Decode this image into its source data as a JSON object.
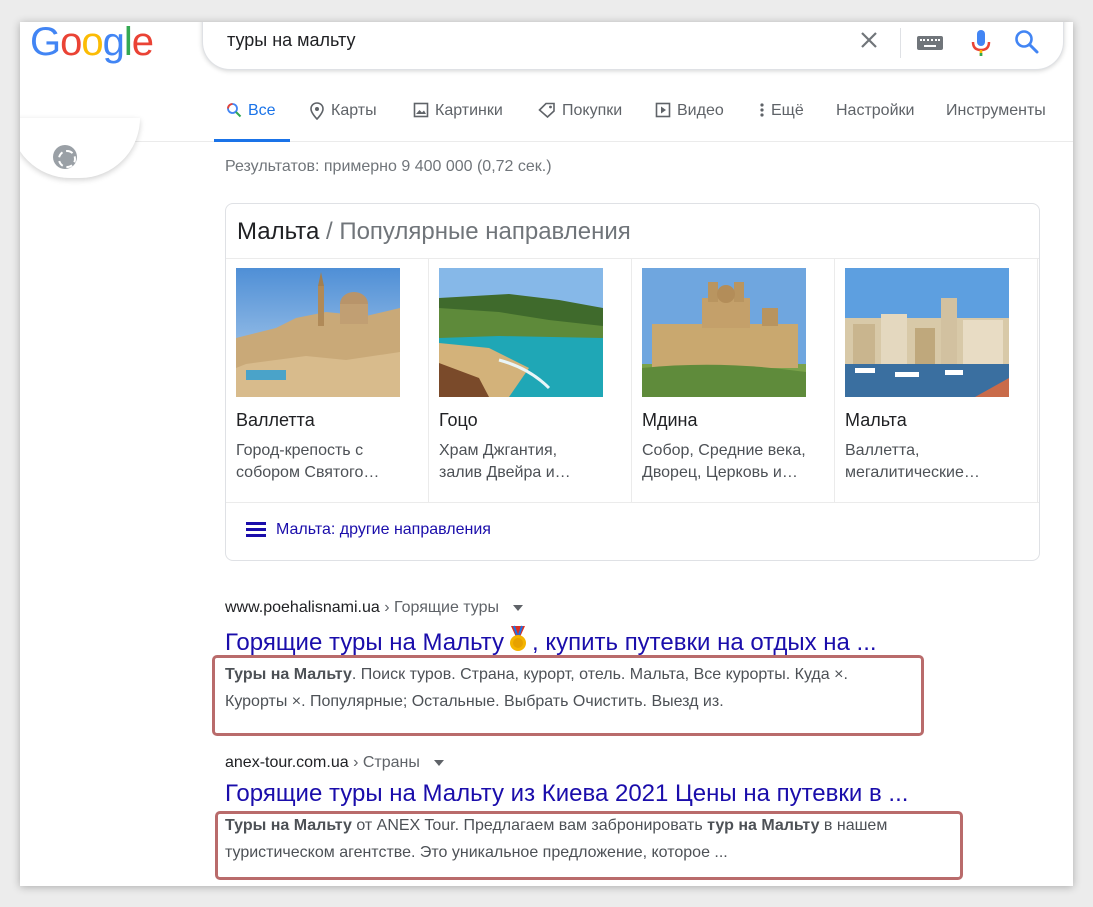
{
  "search": {
    "query": "туры на мальту"
  },
  "logo": [
    "G",
    "o",
    "o",
    "g",
    "l",
    "e"
  ],
  "tabs": [
    {
      "label": "Все",
      "icon": "search-icon"
    },
    {
      "label": "Карты",
      "icon": "map-pin-icon"
    },
    {
      "label": "Картинки",
      "icon": "image-icon"
    },
    {
      "label": "Покупки",
      "icon": "tag-icon"
    },
    {
      "label": "Видео",
      "icon": "play-icon"
    },
    {
      "label": "Ещё",
      "icon": "more-vert-icon"
    },
    {
      "label": "Настройки",
      "icon": ""
    },
    {
      "label": "Инструменты",
      "icon": ""
    }
  ],
  "stats": "Результатов: примерно 9 400 000 (0,72 сек.)",
  "card": {
    "title": "Мальта",
    "subtitle": "/ Популярные направления",
    "places": [
      {
        "name": "Валлетта",
        "desc1": "Город-крепость с",
        "desc2": "собором Святого…"
      },
      {
        "name": "Гоцо",
        "desc1": "Храм Джгантия,",
        "desc2": "залив Двейра и…"
      },
      {
        "name": "Мдина",
        "desc1": "Собор, Средние века,",
        "desc2": "Дворец, Церковь и…"
      },
      {
        "name": "Мальта",
        "desc1": "Валлетта,",
        "desc2": "мегалитические…"
      }
    ],
    "more_link": "Мальта: другие направления"
  },
  "results": [
    {
      "domain": "www.poehalisnami.ua",
      "crumb": "› Горящие туры",
      "title_a": "Горящие туры на Мальту",
      "title_b": ", купить путевки на отдых на ...",
      "snip1_bold": "Туры на Мальту",
      "snip1_rest": ". Поиск туров. Страна, курорт, отель. Мальта, Все курорты. Куда ×.",
      "snip2": "Курорты ×. Популярные; Остальные. Выбрать Очистить. Выезд из."
    },
    {
      "domain": "anex-tour.com.ua",
      "crumb": "› Страны",
      "title": "Горящие туры на Мальту из Киева 2021 Цены на путевки в ...",
      "snip1_bold": "Туры на Мальту",
      "snip1_mid": " от ANEX Tour. Предлагаем вам забронировать ",
      "snip1_bold2": "тур на Мальту",
      "snip1_end": " в нашем",
      "snip2": "туристическом агентстве. Это уникальное предложение, которое ..."
    }
  ],
  "colors": {
    "link": "#1a0dab",
    "accent": "#1a73e8",
    "highlight": "#b96b6b"
  }
}
